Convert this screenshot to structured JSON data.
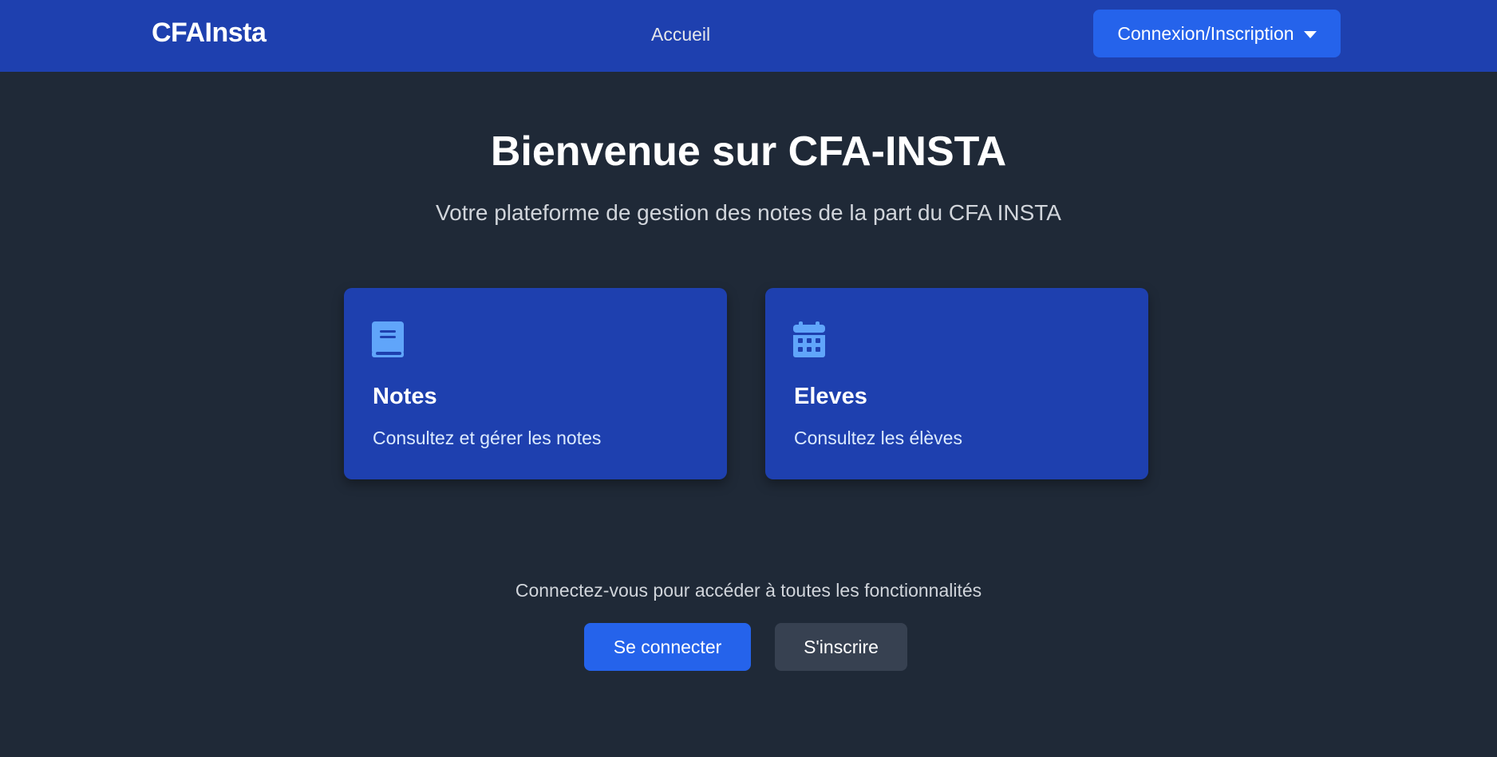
{
  "navbar": {
    "brand": "CFAInsta",
    "links": [
      {
        "label": "Accueil"
      }
    ],
    "auth_dropdown": {
      "label": "Connexion/Inscription",
      "icon": "caret-down-icon"
    }
  },
  "hero": {
    "title": "Bienvenue sur CFA-INSTA",
    "subtitle": "Votre plateforme de gestion des notes de la part du CFA INSTA"
  },
  "cards": [
    {
      "icon": "book-icon",
      "title": "Notes",
      "description": "Consultez et gérer les notes"
    },
    {
      "icon": "calendar-icon",
      "title": "Eleves",
      "description": "Consultez les élèves"
    }
  ],
  "cta": {
    "prompt": "Connectez-vous pour accéder à toutes les fonctionnalités",
    "login_label": "Se connecter",
    "register_label": "S'inscrire"
  },
  "colors": {
    "background": "#1f2937",
    "navbar": "#1e40af",
    "accent": "#2563eb",
    "icon": "#60a5fa",
    "secondary_button": "#374151"
  }
}
